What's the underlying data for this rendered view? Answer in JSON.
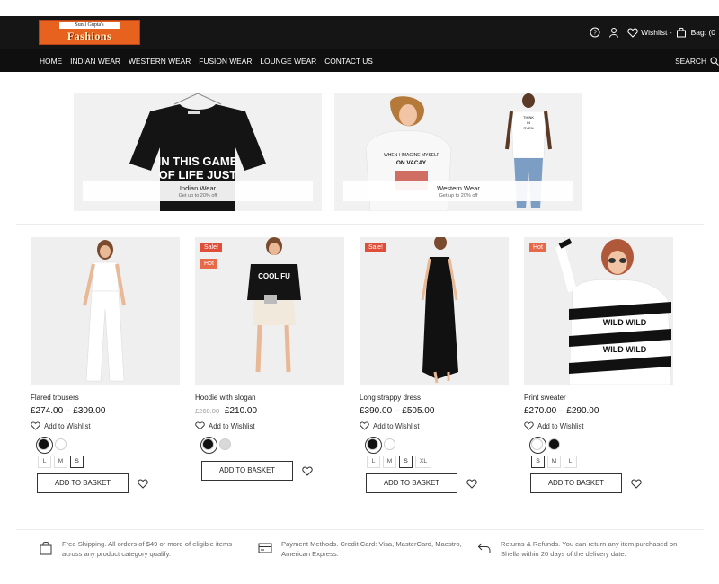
{
  "header": {
    "logo_small": "Sunil Gupta's",
    "logo_big": "Fashions",
    "wishlist_label": "Wishlist -",
    "bag_label": "Bag: (0"
  },
  "nav": {
    "items": [
      "HOME",
      "INDIAN WEAR",
      "WESTERN WEAR",
      "FUSION WEAR",
      "LOUNGE WEAR",
      "CONTACT US"
    ],
    "search_label": "SEARCH"
  },
  "banners": [
    {
      "title": "Indian Wear",
      "subtitle": "Get up to 20% off",
      "shirt_text": "IN THIS GAME OF LIFE JUST"
    },
    {
      "title": "Western Wear",
      "subtitle": "Get up to 20% off",
      "shirt_text": "WHEN I IMAGINE MYSELF ON VACAY."
    }
  ],
  "products": [
    {
      "name": "Flared trousers",
      "price": "£274.00 – £309.00",
      "old_price": "",
      "badges": [],
      "wishlist": "Add to Wishlist",
      "colors": [
        "#111111",
        "#ffffff"
      ],
      "selected_color": 0,
      "sizes": [
        "L",
        "M",
        "S"
      ],
      "selected_size": "S",
      "button": "ADD TO BASKET"
    },
    {
      "name": "Hoodie with slogan",
      "price": "£210.00",
      "old_price": "£260.00",
      "badges": [
        "Sale!",
        "Hot"
      ],
      "wishlist": "Add to Wishlist",
      "colors": [
        "#111111",
        "#d9d9d9"
      ],
      "selected_color": 0,
      "sizes": [],
      "selected_size": "",
      "button": "ADD TO BASKET"
    },
    {
      "name": "Long strappy dress",
      "price": "£390.00 – £505.00",
      "old_price": "",
      "badges": [
        "Sale!"
      ],
      "wishlist": "Add to Wishlist",
      "colors": [
        "#111111",
        "#ffffff"
      ],
      "selected_color": 0,
      "sizes": [
        "L",
        "M",
        "S",
        "XL"
      ],
      "selected_size": "S",
      "button": "ADD TO BASKET"
    },
    {
      "name": "Print sweater",
      "price": "£270.00 – £290.00",
      "old_price": "",
      "badges": [
        "Hot"
      ],
      "wishlist": "Add to Wishlist",
      "colors": [
        "#ffffff",
        "#111111"
      ],
      "selected_color": 0,
      "sizes": [
        "S",
        "M",
        "L"
      ],
      "selected_size": "S",
      "button": "ADD TO BASKET"
    }
  ],
  "features": [
    {
      "icon": "bag-icon",
      "text": "Free Shipping. All orders of $49 or more of eligible items across any product category qualify."
    },
    {
      "icon": "card-icon",
      "text": "Payment Methods. Credit Card: Visa, MasterCard, Maestro, American Express."
    },
    {
      "icon": "return-icon",
      "text": "Returns & Refunds. You can return any item purchased on Shella within 20 days of the delivery date."
    }
  ],
  "colors": {
    "header_bg": "#151515",
    "badge_sale": "#e04e39",
    "badge_hot": "#e8694a",
    "logo_bg": "#e8621f"
  }
}
